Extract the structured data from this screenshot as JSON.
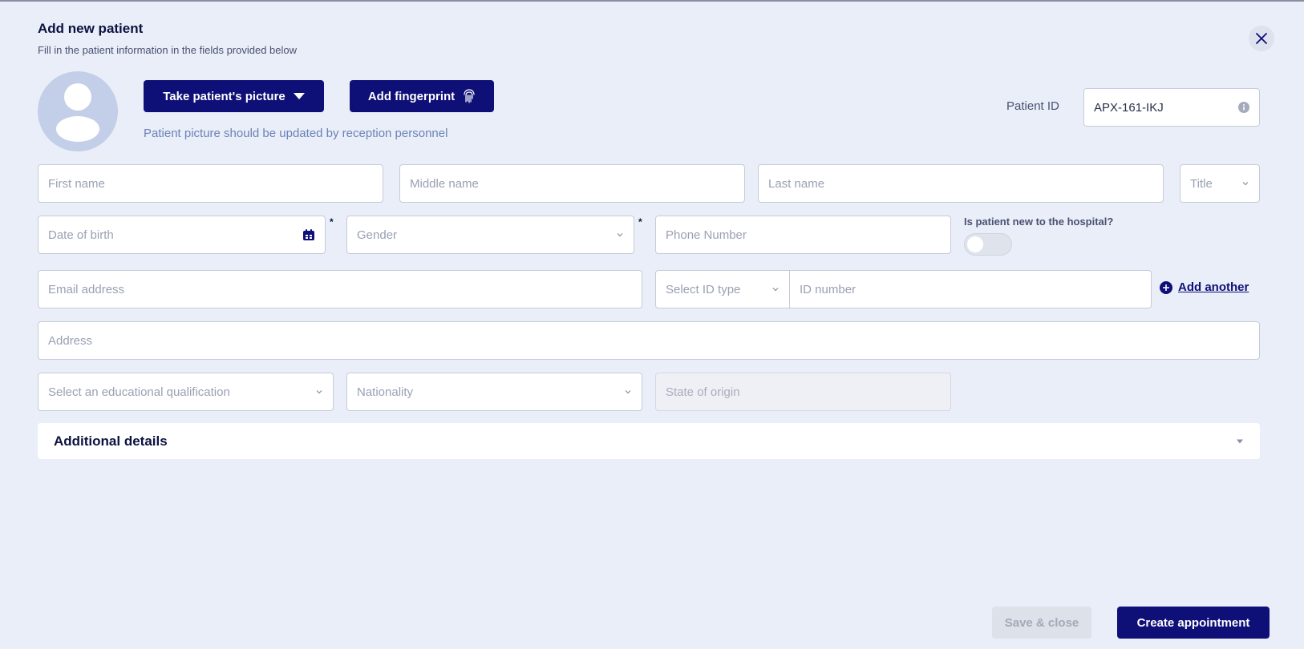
{
  "header": {
    "title": "Add new patient",
    "subtitle": "Fill in the patient information in the fields provided below",
    "close_icon": "close-icon"
  },
  "photo": {
    "take_picture_label": "Take patient's picture",
    "add_fingerprint_label": "Add fingerprint",
    "note": "Patient picture should be updated by reception personnel"
  },
  "patient_id": {
    "label": "Patient ID",
    "value": "APX-161-IKJ",
    "info_icon": "info-icon"
  },
  "form": {
    "first_name": {
      "placeholder": "First name"
    },
    "middle_name": {
      "placeholder": "Middle name"
    },
    "last_name": {
      "placeholder": "Last name"
    },
    "title": {
      "placeholder": "Title"
    },
    "date_of_birth": {
      "placeholder": "Date of birth",
      "required_mark": "*"
    },
    "gender": {
      "placeholder": "Gender",
      "required_mark": "*"
    },
    "phone": {
      "placeholder": "Phone Number"
    },
    "new_patient": {
      "question": "Is patient new to the hospital?",
      "checked": false
    },
    "email": {
      "placeholder": "Email address"
    },
    "id_type": {
      "placeholder": "Select ID type"
    },
    "id_number": {
      "placeholder": "ID number"
    },
    "add_another_label": "Add another",
    "address": {
      "placeholder": "Address"
    },
    "education": {
      "placeholder": "Select an educational qualification"
    },
    "nationality": {
      "placeholder": "Nationality"
    },
    "state_of_origin": {
      "placeholder": "State of origin"
    }
  },
  "additional_details": {
    "title": "Additional details"
  },
  "footer": {
    "save_close_label": "Save & close",
    "create_appointment_label": "Create appointment"
  },
  "colors": {
    "primary": "#0f0f78",
    "background": "#eaeef8",
    "avatar_bg": "#c3cfe8"
  }
}
